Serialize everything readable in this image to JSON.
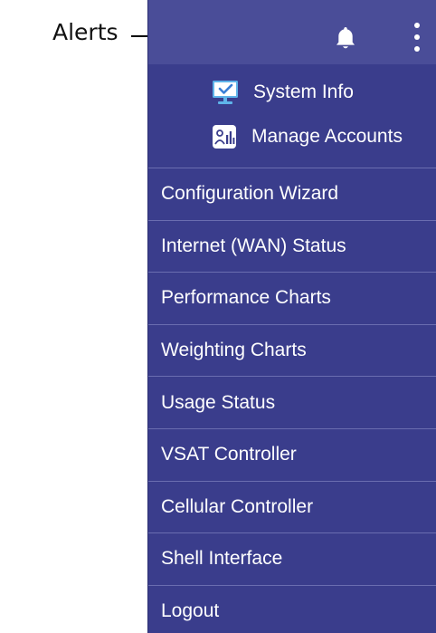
{
  "annotation": {
    "label": "Alerts"
  },
  "header": {
    "alerts_icon": "bell-icon",
    "more_icon": "vertical-ellipsis-icon"
  },
  "quick_links": [
    {
      "label": "System Info",
      "icon": "monitor-check-icon"
    },
    {
      "label": "Manage Accounts",
      "icon": "accounts-chart-icon"
    }
  ],
  "menu": [
    {
      "label": "Configuration Wizard"
    },
    {
      "label": "Internet (WAN) Status"
    },
    {
      "label": "Performance Charts"
    },
    {
      "label": "Weighting Charts"
    },
    {
      "label": "Usage Status"
    },
    {
      "label": "VSAT Controller"
    },
    {
      "label": "Cellular Controller"
    },
    {
      "label": "Shell Interface"
    },
    {
      "label": "Logout"
    }
  ],
  "colors": {
    "panel_bg": "#3a3d8c",
    "header_bg": "#4a4d98",
    "divider": "#6a6db0",
    "text": "#ffffff",
    "icon_blue": "#5fb4ea"
  }
}
